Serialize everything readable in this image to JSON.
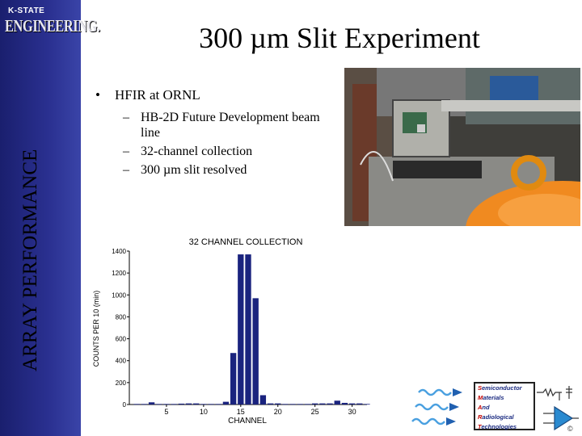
{
  "sidebar": {
    "logo_top": "K-STATE",
    "logo_main": "ENGINEERING.",
    "vertical_title": "ARRAY PERFORMANCE"
  },
  "slide": {
    "title": "300 µm Slit Experiment",
    "bullet": "HFIR at ORNL",
    "subbullets": [
      "HB-2D Future Development beam line",
      "32-channel collection",
      "300 µm slit resolved"
    ]
  },
  "chart_data": {
    "type": "bar",
    "title": "32 CHANNEL COLLECTION",
    "xlabel": "CHANNEL",
    "ylabel": "COUNTS PER 10 (min)",
    "ylim": [
      0,
      1400
    ],
    "yticks": [
      0,
      200,
      400,
      600,
      800,
      1000,
      1200,
      1400
    ],
    "xticks": [
      5,
      10,
      15,
      20,
      25,
      30
    ],
    "xlim": [
      0,
      32
    ],
    "x": [
      1,
      2,
      3,
      4,
      5,
      6,
      7,
      8,
      9,
      10,
      11,
      12,
      13,
      14,
      15,
      16,
      17,
      18,
      19,
      20,
      21,
      22,
      23,
      24,
      25,
      26,
      27,
      28,
      29,
      30,
      31,
      32
    ],
    "values": [
      5,
      5,
      20,
      5,
      5,
      5,
      8,
      10,
      10,
      5,
      5,
      5,
      25,
      470,
      1370,
      1370,
      970,
      85,
      10,
      10,
      5,
      5,
      5,
      5,
      10,
      10,
      10,
      35,
      15,
      10,
      10,
      5
    ],
    "bar_color": "#1a237e"
  },
  "footer": {
    "smrt_lines": [
      {
        "cap": "S",
        "rest": "emiconductor"
      },
      {
        "cap": "M",
        "rest": "aterials"
      },
      {
        "cap": "A",
        "rest": "nd"
      },
      {
        "cap": "R",
        "rest": "adiological"
      },
      {
        "cap": "T",
        "rest": "echnologies"
      }
    ],
    "copyright": "©"
  }
}
